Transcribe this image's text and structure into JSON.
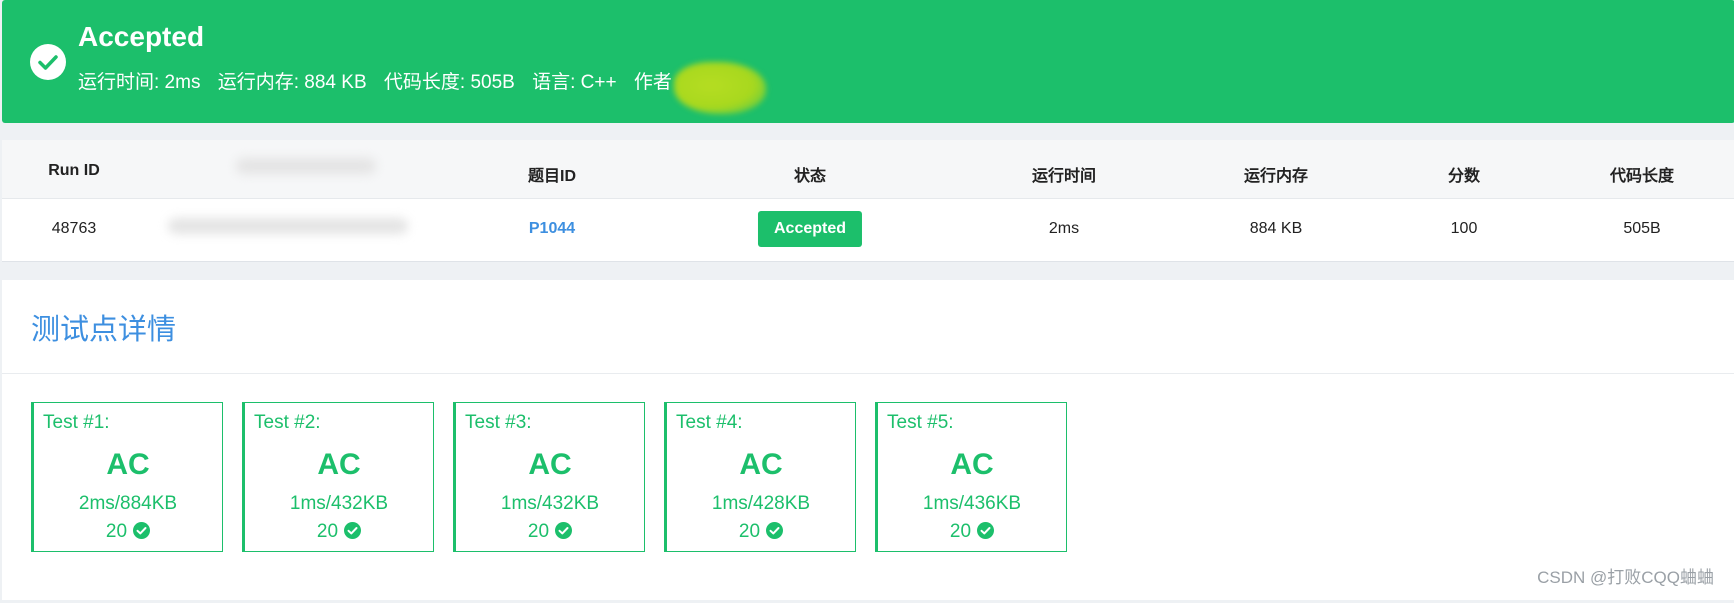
{
  "banner": {
    "title": "Accepted",
    "runtime": "运行时间: 2ms",
    "memory": "运行内存: 884 KB",
    "code_length": "代码长度: 505B",
    "language": "语言: C++",
    "author": "作者",
    "color": "#1cbf6b"
  },
  "run_table": {
    "headers": [
      "Run ID",
      "题目ID",
      "状态",
      "运行时间",
      "运行内存",
      "分数",
      "代码长度"
    ],
    "row": {
      "run_id": "48763",
      "problem_id": "P1044",
      "status": "Accepted",
      "runtime": "2ms",
      "memory": "884 KB",
      "score": "100",
      "code_length": "505B"
    }
  },
  "tests": {
    "title": "测试点详情",
    "cases": [
      {
        "label": "Test #1:",
        "result": "AC",
        "stats": "2ms/884KB",
        "score": "20"
      },
      {
        "label": "Test #2:",
        "result": "AC",
        "stats": "1ms/432KB",
        "score": "20"
      },
      {
        "label": "Test #3:",
        "result": "AC",
        "stats": "1ms/432KB",
        "score": "20"
      },
      {
        "label": "Test #4:",
        "result": "AC",
        "stats": "1ms/428KB",
        "score": "20"
      },
      {
        "label": "Test #5:",
        "result": "AC",
        "stats": "1ms/436KB",
        "score": "20"
      }
    ]
  },
  "watermark": "CSDN @打败CQQ蛐蛐"
}
